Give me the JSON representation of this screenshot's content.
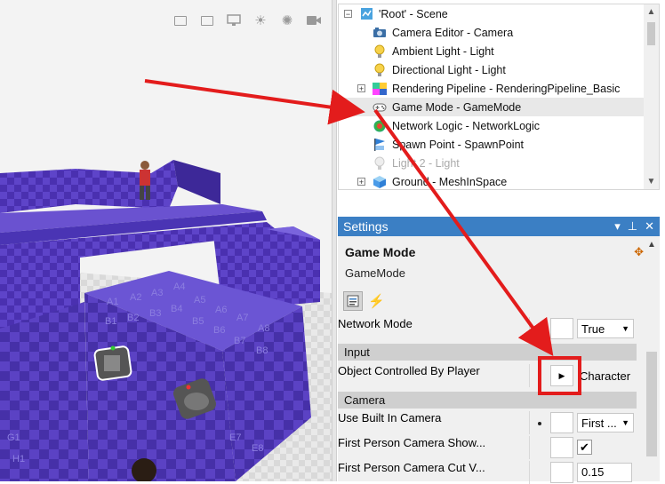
{
  "viewport": {
    "toolbar_icons": [
      "window-icon",
      "window-icon",
      "monitor-icon",
      "sun-icon",
      "sun-icon",
      "camera-icon"
    ],
    "block_labels": [
      "A1",
      "A2",
      "A3",
      "A4",
      "A5",
      "A6",
      "A7",
      "A8",
      "B1",
      "B2",
      "B3",
      "B4",
      "B5",
      "B6",
      "B7",
      "B8",
      "E7",
      "E8",
      "G1",
      "H1"
    ]
  },
  "tree": {
    "items": [
      {
        "label": "'Root' - Scene",
        "icon": "scene-icon",
        "expander": "−"
      },
      {
        "label": "Camera Editor - Camera",
        "icon": "camera-icon",
        "expander": ""
      },
      {
        "label": "Ambient Light - Light",
        "icon": "bulb-icon",
        "expander": ""
      },
      {
        "label": "Directional Light - Light",
        "icon": "bulb-icon",
        "expander": ""
      },
      {
        "label": "Rendering Pipeline - RenderingPipeline_Basic",
        "icon": "pipeline-icon",
        "expander": "+"
      },
      {
        "label": "Game Mode - GameMode",
        "icon": "gamepad-icon",
        "expander": ""
      },
      {
        "label": "Network Logic - NetworkLogic",
        "icon": "network-icon",
        "expander": ""
      },
      {
        "label": "Spawn Point - SpawnPoint",
        "icon": "flag-icon",
        "expander": ""
      },
      {
        "label": "Light 2 - Light",
        "icon": "bulb-off-icon",
        "expander": ""
      },
      {
        "label": "Ground - MeshInSpace",
        "icon": "cube-icon",
        "expander": "+"
      }
    ]
  },
  "settings": {
    "header": "Settings",
    "object_title": "Game Mode",
    "object_type": "GameMode",
    "network_mode_label": "Network Mode",
    "network_mode_value": "True",
    "cat_input": "Input",
    "object_controlled_label": "Object Controlled By Player",
    "object_controlled_value": "Character",
    "cat_camera": "Camera",
    "use_builtin_camera_label": "Use Built In Camera",
    "use_builtin_camera_value": "First ...",
    "first_person_show_label": "First Person Camera Show...",
    "first_person_cut_label": "First Person Camera Cut V...",
    "first_person_cut_value": "0.15"
  },
  "colors": {
    "accent": "#3b7fc4",
    "arrow": "#e31c1c",
    "block": "#5a3fc0"
  }
}
